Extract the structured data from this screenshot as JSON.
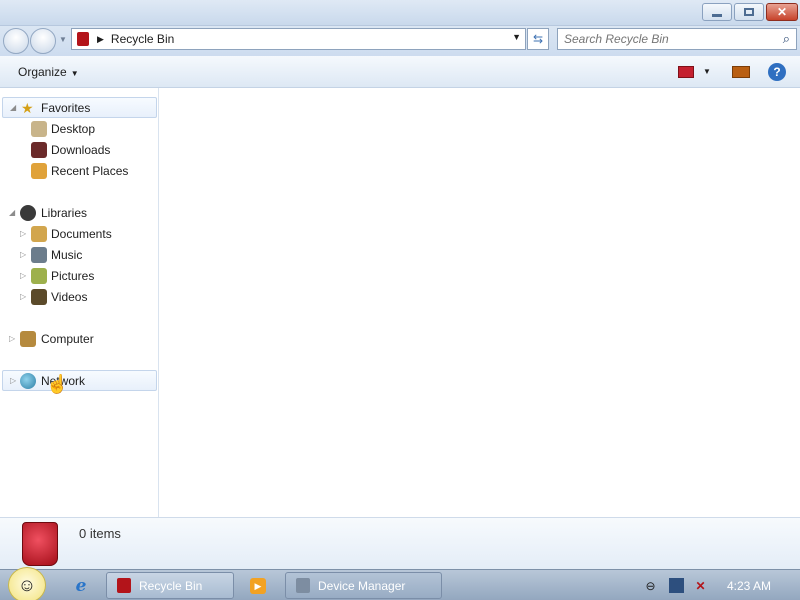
{
  "window": {
    "controls": {
      "minimize_icon": "minimize-icon",
      "maximize_icon": "restore-icon",
      "close_icon": "close-icon"
    }
  },
  "address": {
    "path_icon": "recycle-bin-icon",
    "path_label": "Recycle Bin",
    "search_placeholder": "Search Recycle Bin"
  },
  "toolbar": {
    "organize_label": "Organize",
    "view_icon": "view-options-icon",
    "preview_icon": "preview-pane-icon",
    "help_icon": "help-icon"
  },
  "nav": {
    "favorites": {
      "label": "Favorites",
      "items": [
        "Desktop",
        "Downloads",
        "Recent Places"
      ]
    },
    "libraries": {
      "label": "Libraries",
      "items": [
        "Documents",
        "Music",
        "Pictures",
        "Videos"
      ]
    },
    "computer_label": "Computer",
    "network_label": "Network"
  },
  "details": {
    "count_text": "0 items"
  },
  "taskbar": {
    "tasks": [
      "Recycle Bin",
      "Device Manager"
    ],
    "clock": "4:23 AM"
  },
  "colors": {
    "accent": "#2f6fc1",
    "recycle_red": "#b3141a"
  }
}
